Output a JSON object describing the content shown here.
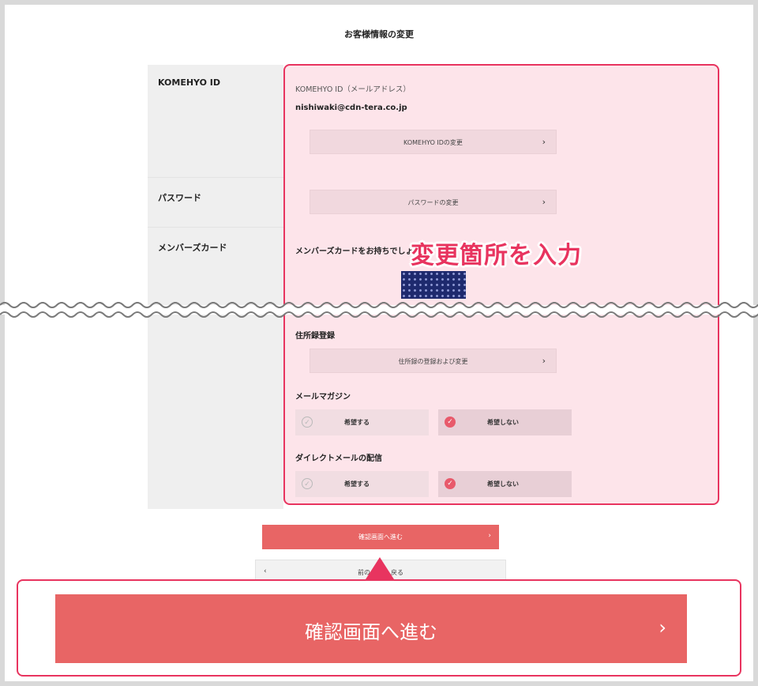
{
  "page": {
    "title": "お客様情報の変更"
  },
  "rows": {
    "komehyo_id": "KOMEHYO ID",
    "password": "パスワード",
    "member_card": "メンバーズカード"
  },
  "komehyo": {
    "field_label": "KOMEHYO ID（メールアドレス）",
    "email": "nishiwaki@cdn-tera.co.jp",
    "change_button": "KOMEHYO IDの変更"
  },
  "password": {
    "change_button": "パスワードの変更"
  },
  "member_card": {
    "question": "メンバーズカードをお持ちでしょ"
  },
  "callout": {
    "text": "変更箇所を入力"
  },
  "address": {
    "title": "住所録登録",
    "button": "住所録の登録および変更"
  },
  "mail_magazine": {
    "title": "メールマガジン",
    "options": [
      "希望する",
      "希望しない"
    ],
    "selected": "希望しない"
  },
  "direct_mail": {
    "title": "ダイレクトメールの配信",
    "options": [
      "希望する",
      "希望しない"
    ],
    "selected": "希望しない"
  },
  "actions": {
    "submit": "確認画面へ進む",
    "back": "前の画面に戻る",
    "back_visible_left": "前の",
    "back_visible_right": "戻る"
  },
  "icons": {
    "chevron_right": "›",
    "chevron_left": "‹",
    "check": "✓"
  },
  "colors": {
    "accent": "#e8345f",
    "primary_button": "#e86565",
    "panel_bg": "#fde4ea",
    "card": "#1e2a6e"
  }
}
